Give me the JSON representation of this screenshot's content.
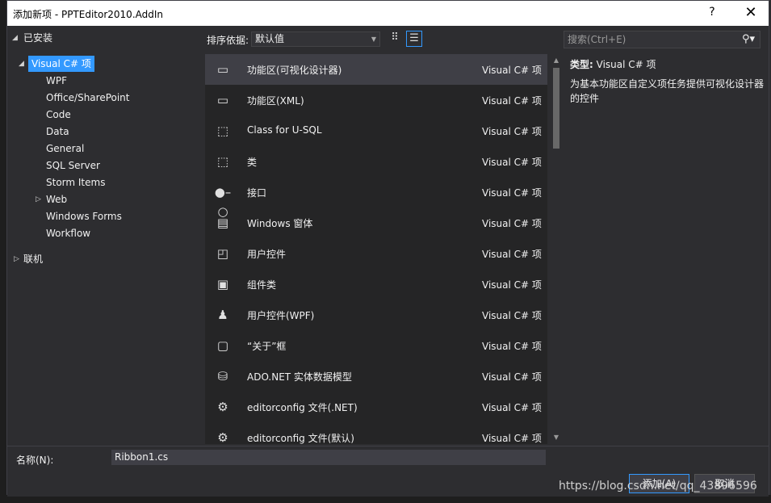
{
  "window": {
    "title": "添加新项 - PPTEditor2010.AddIn",
    "help": "?",
    "close": "✕"
  },
  "tree": {
    "installed": "已安装",
    "visual_csharp": "Visual C# 项",
    "children": [
      "WPF",
      "Office/SharePoint",
      "Code",
      "Data",
      "General",
      "SQL Server",
      "Storm Items",
      "Web",
      "Windows Forms",
      "Workflow"
    ],
    "online": "联机"
  },
  "toolbar": {
    "sort_label": "排序依据:",
    "sort_value": "默认值",
    "search_placeholder": "搜索(Ctrl+E)"
  },
  "templates": [
    {
      "name": "功能区(可视化设计器)",
      "type": "Visual C# 项",
      "icon": "ribbon-icon"
    },
    {
      "name": "功能区(XML)",
      "type": "Visual C# 项",
      "icon": "ribbon-icon"
    },
    {
      "name": "Class for U-SQL",
      "type": "Visual C# 项",
      "icon": "csharp-class-icon"
    },
    {
      "name": "类",
      "type": "Visual C# 项",
      "icon": "csharp-class-icon"
    },
    {
      "name": "接口",
      "type": "Visual C# 项",
      "icon": "interface-icon"
    },
    {
      "name": "Windows 窗体",
      "type": "Visual C# 项",
      "icon": "form-icon"
    },
    {
      "name": "用户控件",
      "type": "Visual C# 项",
      "icon": "user-control-icon"
    },
    {
      "name": "组件类",
      "type": "Visual C# 项",
      "icon": "component-icon"
    },
    {
      "name": "用户控件(WPF)",
      "type": "Visual C# 项",
      "icon": "wpf-user-control-icon"
    },
    {
      "name": "“关于”框",
      "type": "Visual C# 项",
      "icon": "about-box-icon"
    },
    {
      "name": "ADO.NET 实体数据模型",
      "type": "Visual C# 项",
      "icon": "entity-model-icon"
    },
    {
      "name": "editorconfig 文件(.NET)",
      "type": "Visual C# 项",
      "icon": "config-file-icon"
    },
    {
      "name": "editorconfig 文件(默认)",
      "type": "Visual C# 项",
      "icon": "config-file-icon"
    }
  ],
  "details": {
    "type_label": "类型:",
    "type_value": "Visual C# 项",
    "description": "为基本功能区自定义项任务提供可视化设计器的控件"
  },
  "footer": {
    "name_label": "名称(N):",
    "name_value": "Ribbon1.cs",
    "add_button": "添加(A)",
    "cancel_button": "取消"
  },
  "watermark": "https://blog.csdn.net/qq_43896596",
  "colors": {
    "selection": "#3399ff",
    "background": "#2d2d30",
    "list_bg": "#252526"
  }
}
